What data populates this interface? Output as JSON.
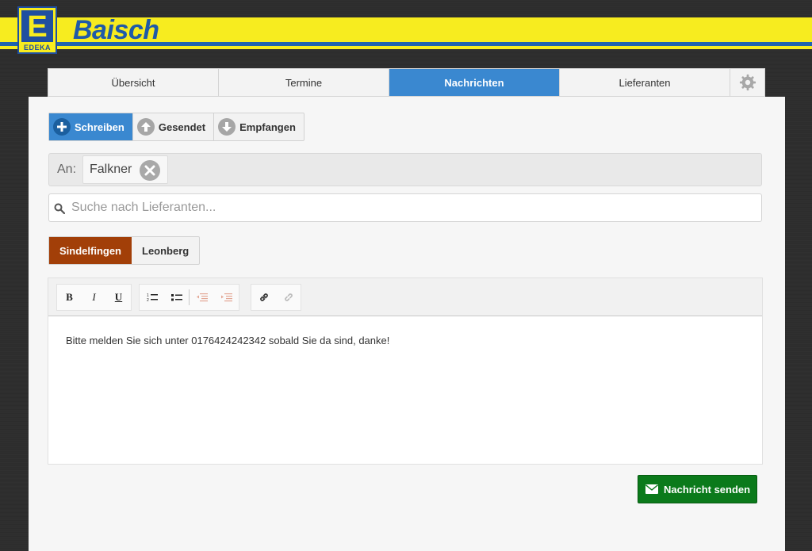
{
  "brand": {
    "logo_letter": "E",
    "logo_text": "EDEKA",
    "name": "Baisch"
  },
  "tabs": [
    {
      "label": "Übersicht"
    },
    {
      "label": "Termine"
    },
    {
      "label": "Nachrichten"
    },
    {
      "label": "Lieferanten"
    }
  ],
  "message_modes": [
    {
      "label": "Schreiben",
      "icon": "plus-icon"
    },
    {
      "label": "Gesendet",
      "icon": "arrow-up-icon"
    },
    {
      "label": "Empfangen",
      "icon": "arrow-down-icon"
    }
  ],
  "recipients": {
    "label": "An:",
    "items": [
      {
        "name": "Falkner"
      }
    ]
  },
  "search": {
    "placeholder": "Suche nach Lieferanten..."
  },
  "locations": [
    {
      "label": "Sindelfingen"
    },
    {
      "label": "Leonberg"
    }
  ],
  "editor": {
    "toolbar": {
      "bold": "B",
      "italic": "I",
      "underline": "U"
    },
    "content": "Bitte melden Sie sich unter 0176424242342 sobald Sie da sind, danke!"
  },
  "send_button": {
    "label": "Nachricht senden"
  },
  "colors": {
    "accent_blue": "#3a88d0",
    "location_active": "#a23f08",
    "send_green": "#0b7a1b",
    "brand_yellow": "#f7ec1f"
  }
}
